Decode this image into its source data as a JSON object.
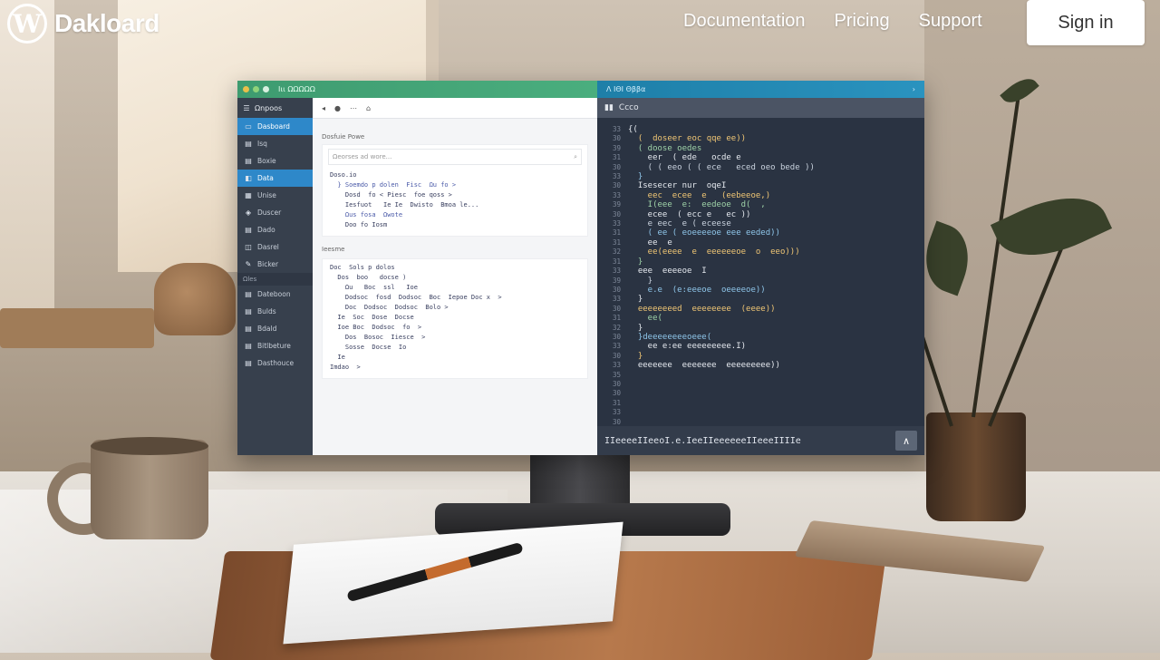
{
  "site": {
    "logo_letter": "W",
    "brand": "Dakloard"
  },
  "nav": {
    "items": [
      "Documentation",
      "Pricing",
      "Support"
    ],
    "signin": "Sign in"
  },
  "left_app": {
    "title": "Ιιι ΩΩΩΩΩ",
    "sidebar_header": "Ωnpoos",
    "sidebar": [
      {
        "icon": "▭",
        "label": "Dasboard",
        "active": true
      },
      {
        "icon": "▤",
        "label": "Ιsq",
        "active": false
      },
      {
        "icon": "▤",
        "label": "Boxie",
        "active": false
      },
      {
        "icon": "◧",
        "label": "Data",
        "active": true
      },
      {
        "icon": "▦",
        "label": "Unise",
        "active": false
      },
      {
        "icon": "◈",
        "label": "Duscer",
        "active": false
      },
      {
        "icon": "▤",
        "label": "Dado",
        "active": false
      },
      {
        "icon": "◫",
        "label": "Dasrel",
        "active": false
      },
      {
        "icon": "✎",
        "label": "Bicker",
        "active": false
      }
    ],
    "sidebar_section": "Ωles",
    "sidebar_bottom": [
      "Dateboon",
      "Bulds",
      "Bdald",
      "Bitlbeture",
      "Dasthouce"
    ],
    "toolbar": [
      "◂",
      "●",
      "⋯",
      "⌂"
    ],
    "section1_label": "Dosfuie  Ρowe",
    "search_placeholder": "Ωeorses  ad wore...",
    "block1": [
      "Doso.io",
      "  } Soemdo p dolen  Fisc  Ωu fo >",
      "    Dosd  fo < Ρiesc  foe qoss >",
      "    Ιesfuot   Ιe Ιe  Dwisto  Bmoa le...",
      "    Ωus fosa  Ωwote",
      "    Doo fo Ιosm"
    ],
    "section2_label": "Ιeesme",
    "block2": [
      "Doc  Sols p dolos",
      "  Dos  boo   docse )",
      "    Ωu   Boc  ssl   Ιoe",
      "    Dodsoc  fosd  Dodsoc  Boc  Ιepoe Doc x  >",
      "    Doc  Dodsoc  Dodsoc  Bolo >",
      "  Ιe  Soc  Dose  Docse",
      "  Ιoe Boc  Dodsoc  fo  >",
      "    Dos  Bosoc  Ιiesce  >",
      "    Sosse  Docse  Ιo",
      "  Ιe",
      "Ιmdao  >"
    ]
  },
  "right_app": {
    "title": "Λ  ΙΘΙ Θββα",
    "collapse": "›",
    "file_icon": "▮▮",
    "file_name": "Ccco",
    "gutter": [
      "33",
      "30",
      "39",
      "31",
      "30",
      "33",
      "30",
      "33",
      "39",
      "30",
      "33",
      "31",
      "31",
      "32",
      "31",
      "33",
      "39",
      "30",
      "33",
      "30",
      "31",
      "32",
      "30",
      "33",
      "30",
      "33",
      "35",
      "30",
      "30",
      "31",
      "33",
      "30"
    ],
    "code": [
      "{(",
      "  (  doseer eoc qqe ee))",
      "  ( doose oedes",
      "    eer  ( ede   ocde e",
      "    ( ( eeo ( ( ece   eced oeo bede ))",
      "  }",
      "  Ιsesecer nur  oqeI",
      "    eec  ecee  e   (eebeeoe,)",
      "    Ι(eee  e:  eedeoe  d(  ,",
      "    ecee  ( ecc e   ec ))",
      "    e eec  e ( eceese",
      "    ( ee ( eoeeeeoe eee eeded))",
      "    ee  e",
      "    ee(eeee  e  eeeeeeoe  o  eeo)))",
      "  }",
      "  eee  eeeeoe  Ι",
      "    }",
      "    e.e  (e:eeeoe  oeeeeoe))",
      "  }",
      "  eeeeeeeed  eeeeeeee  (eeee))",
      "    ee(",
      "  }",
      "",
      "  }deeeeeeeeoeee(",
      "    ee e:ee eeeeeeeee.Ι)",
      "  }",
      "",
      "  eeeeeee  eeeeeee  eeeeeeeee))"
    ],
    "status": "ΙΙeeeeΙΙeeoΙ.e.ΙeeΙΙeeeeeeΙΙeeeΙΙΙΙe",
    "scroll_up": "∧"
  }
}
